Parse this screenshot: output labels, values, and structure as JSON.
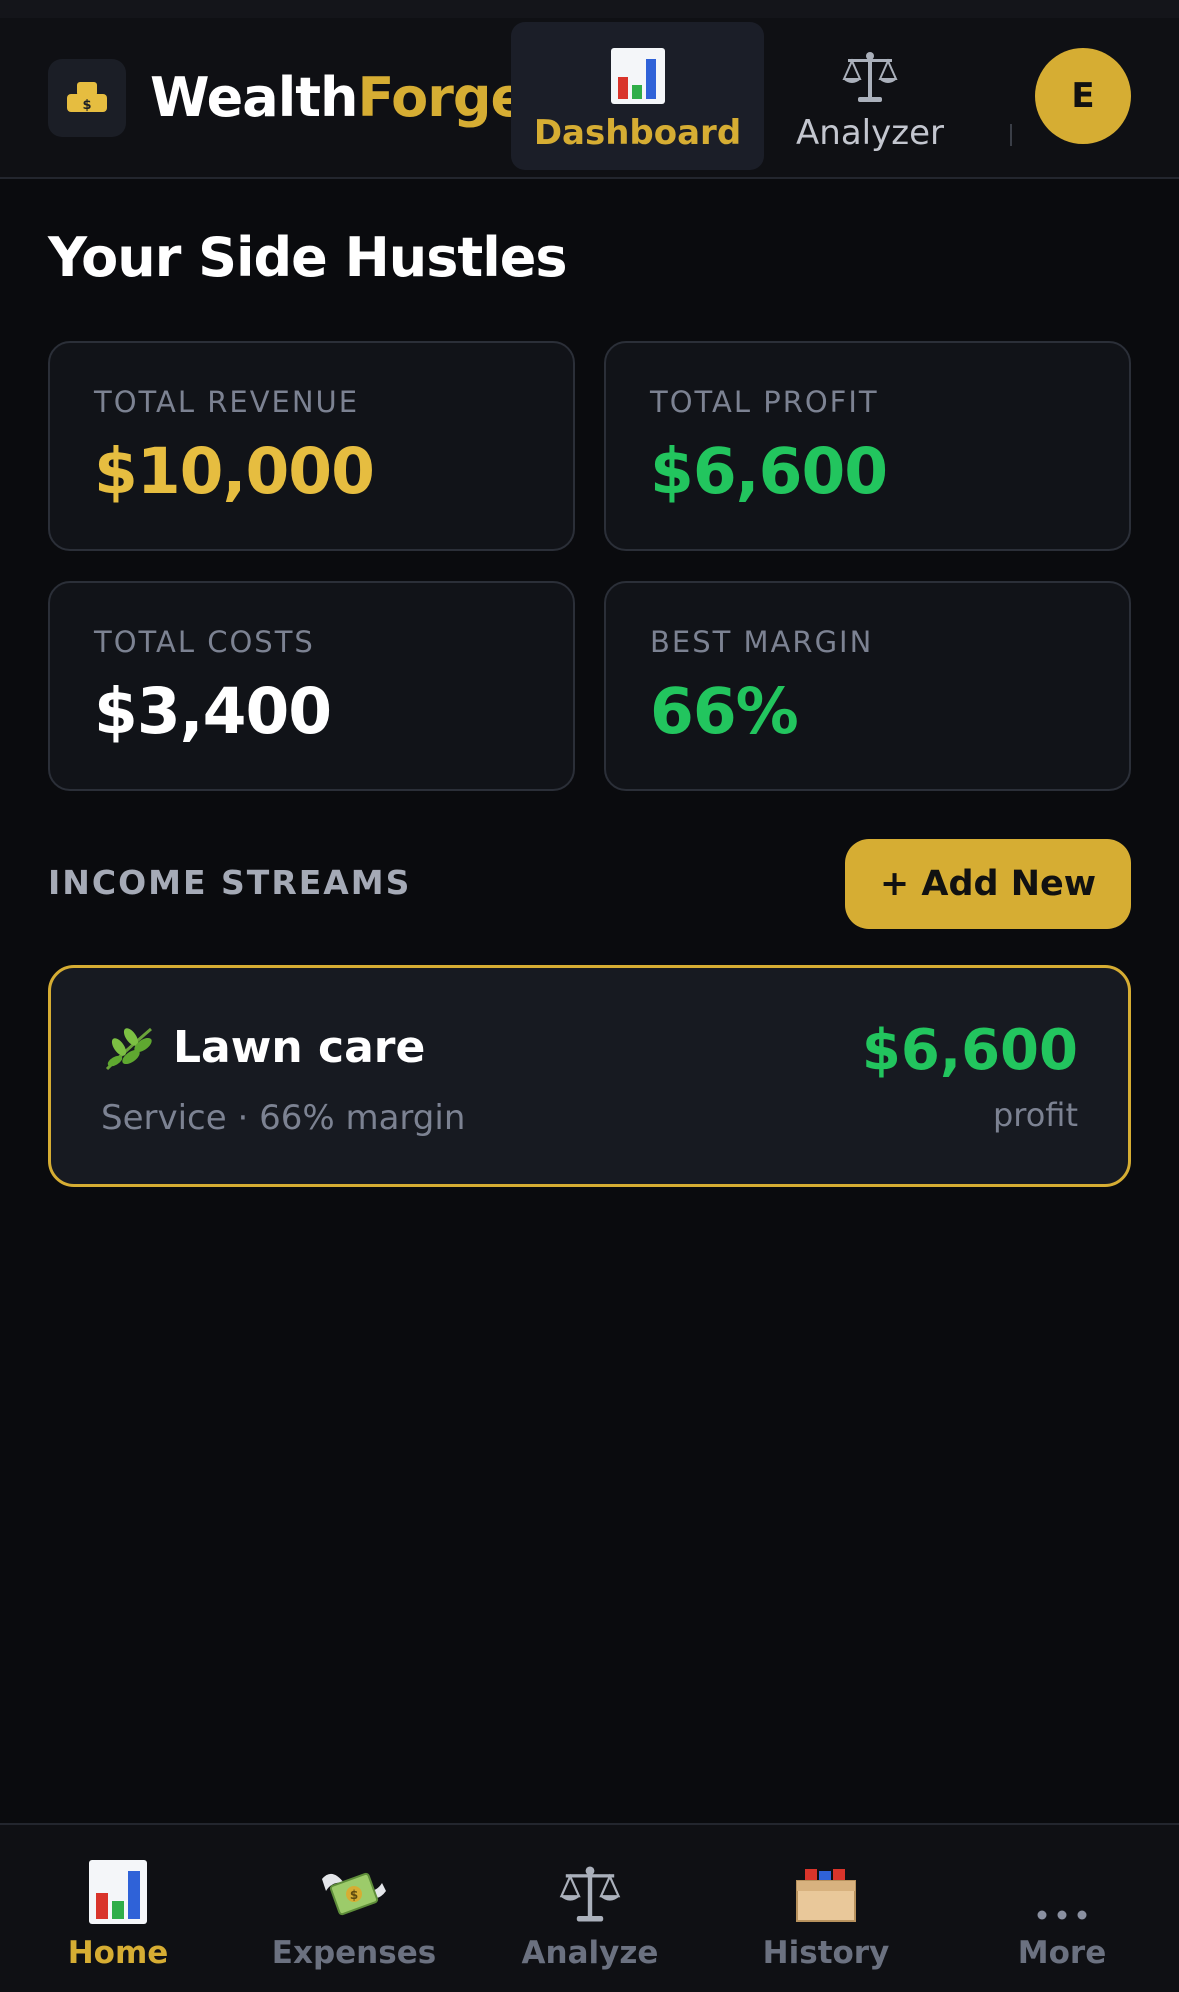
{
  "header": {
    "brand_part1": "Wealth",
    "brand_part2": "Forge",
    "tabs": [
      {
        "label": "Dashboard",
        "icon": "bar-chart-icon",
        "active": true
      },
      {
        "label": "Analyzer",
        "icon": "scales-icon",
        "active": false
      }
    ],
    "avatar_initial": "E"
  },
  "page": {
    "title": "Your Side Hustles"
  },
  "stats": [
    {
      "label": "TOTAL REVENUE",
      "value": "$10,000",
      "color": "#e6bd40"
    },
    {
      "label": "TOTAL PROFIT",
      "value": "$6,600",
      "color": "#22c55e"
    },
    {
      "label": "TOTAL COSTS",
      "value": "$3,400",
      "color": "#ffffff"
    },
    {
      "label": "BEST MARGIN",
      "value": "66%",
      "color": "#22c55e"
    }
  ],
  "streams_section": {
    "label": "INCOME STREAMS",
    "add_button": "+ Add New",
    "items": [
      {
        "icon": "leaf-icon",
        "name": "Lawn care",
        "meta": "Service · 66% margin",
        "profit": "$6,600",
        "profit_label": "profit"
      }
    ]
  },
  "bottom_nav": [
    {
      "label": "Home",
      "icon": "bar-chart-icon",
      "active": true
    },
    {
      "label": "Expenses",
      "icon": "money-wings-icon",
      "active": false
    },
    {
      "label": "Analyze",
      "icon": "scales-icon",
      "active": false
    },
    {
      "label": "History",
      "icon": "card-box-icon",
      "active": false
    },
    {
      "label": "More",
      "icon": "more-dots-icon",
      "active": false
    }
  ],
  "colors": {
    "accent": "#d6ad33",
    "profit_green": "#22c55e",
    "background": "#0a0b0e"
  }
}
